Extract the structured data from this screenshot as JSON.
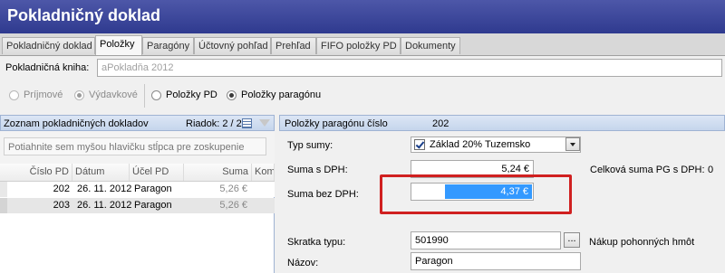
{
  "window": {
    "title": "Pokladničný doklad"
  },
  "tabs": [
    {
      "label": "Pokladničný doklad"
    },
    {
      "label": "Položky"
    },
    {
      "label": "Paragóny"
    },
    {
      "label": "Účtovný pohľad"
    },
    {
      "label": "Prehľad"
    },
    {
      "label": "FIFO položky PD"
    },
    {
      "label": "Dokumenty"
    }
  ],
  "kniha": {
    "label": "Pokladničná kniha:",
    "value": "aPokladňa 2012"
  },
  "filters": {
    "prijmove": "Príjmové",
    "vydavkove": "Výdavkové",
    "polozky_pd": "Položky PD",
    "polozky_paragonu": "Položky paragónu"
  },
  "left": {
    "header": "Zoznam pokladničných dokladov",
    "riadok": "Riadok: 2 / 2",
    "group_hint": "Potiahnite sem myšou hlavičku stĺpca pre zoskupenie",
    "columns": [
      "Číslo PD",
      "Dátum",
      "Účel PD",
      "Suma",
      "Komu"
    ],
    "rows": [
      {
        "cislo": "202",
        "datum": "26. 11. 2012",
        "ucel": "Paragon",
        "suma": "5,26 €"
      },
      {
        "cislo": "203",
        "datum": "26. 11. 2012",
        "ucel": "Paragon",
        "suma": "5,26 €"
      }
    ]
  },
  "right": {
    "header_label": "Položky paragónu číslo",
    "header_number": "202",
    "typ_sumy_label": "Typ sumy:",
    "typ_sumy_value": "Základ 20% Tuzemsko",
    "suma_s_dph_label": "Suma s DPH:",
    "suma_s_dph_value": "5,24 €",
    "celkova_label": "Celková suma PG s DPH:",
    "celkova_value": "0",
    "suma_bez_dph_label": "Suma bez DPH:",
    "suma_bez_dph_value": "4,37 €",
    "skratka_label": "Skratka typu:",
    "skratka_value": "501990",
    "skratka_desc": "Nákup pohonných hmôt",
    "nazov_label": "Názov:",
    "nazov_value": "Paragon",
    "ellipsis": "..."
  },
  "colors": {
    "title_bar": "#2f3a8f",
    "highlight": "#3399ff",
    "annotation": "#d02020"
  }
}
